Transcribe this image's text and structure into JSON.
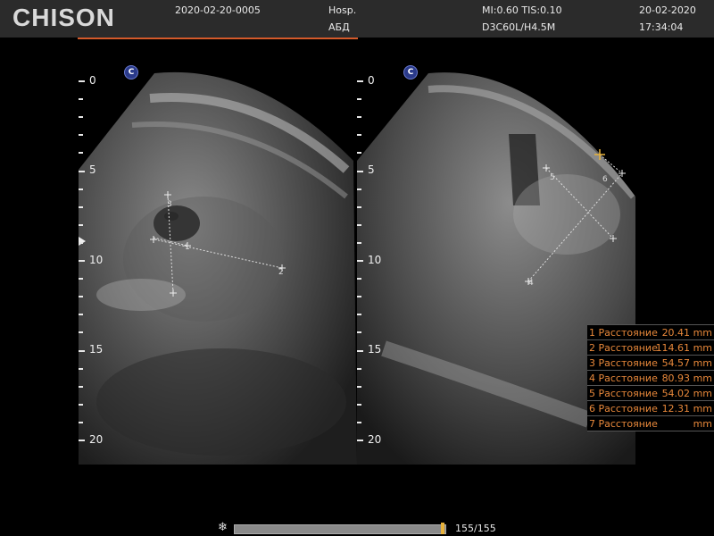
{
  "header": {
    "logo": "CHISON",
    "patient_id": "2020-02-20-0005",
    "hospital": "Hosp.",
    "exam": "АБД",
    "mi_tis": "MI:0.60  TIS:0.10",
    "probe": "D3C60L/H4.5M",
    "date": "20-02-2020",
    "time": "17:34:04"
  },
  "depth_scale": {
    "labels": [
      "0",
      "5",
      "10",
      "15",
      "20"
    ],
    "unit": "cm"
  },
  "panes": [
    {
      "badge": "C",
      "markers": [
        "3",
        "1",
        "2"
      ]
    },
    {
      "badge": "C",
      "markers": [
        "5",
        "6",
        "4"
      ]
    }
  ],
  "measurements": [
    {
      "index": "1",
      "label": "Расстояние",
      "value": "20.41",
      "unit": "mm"
    },
    {
      "index": "2",
      "label": "Расстояние",
      "value": "114.61",
      "unit": "mm"
    },
    {
      "index": "3",
      "label": "Расстояние",
      "value": "54.57",
      "unit": "mm"
    },
    {
      "index": "4",
      "label": "Расстояние",
      "value": "80.93",
      "unit": "mm"
    },
    {
      "index": "5",
      "label": "Расстояние",
      "value": "54.02",
      "unit": "mm"
    },
    {
      "index": "6",
      "label": "Расстояние",
      "value": "12.31",
      "unit": "mm"
    },
    {
      "index": "7",
      "label": "Расстояние",
      "value": "",
      "unit": "mm"
    }
  ],
  "cine": {
    "counter": "155/155",
    "progress": 1.0,
    "icon": "snowflake-icon"
  },
  "colors": {
    "accent": "#d45a2a",
    "measurement": "#e8883a",
    "cine_thumb": "#e8b23a",
    "badge": "#2a3a8a"
  }
}
